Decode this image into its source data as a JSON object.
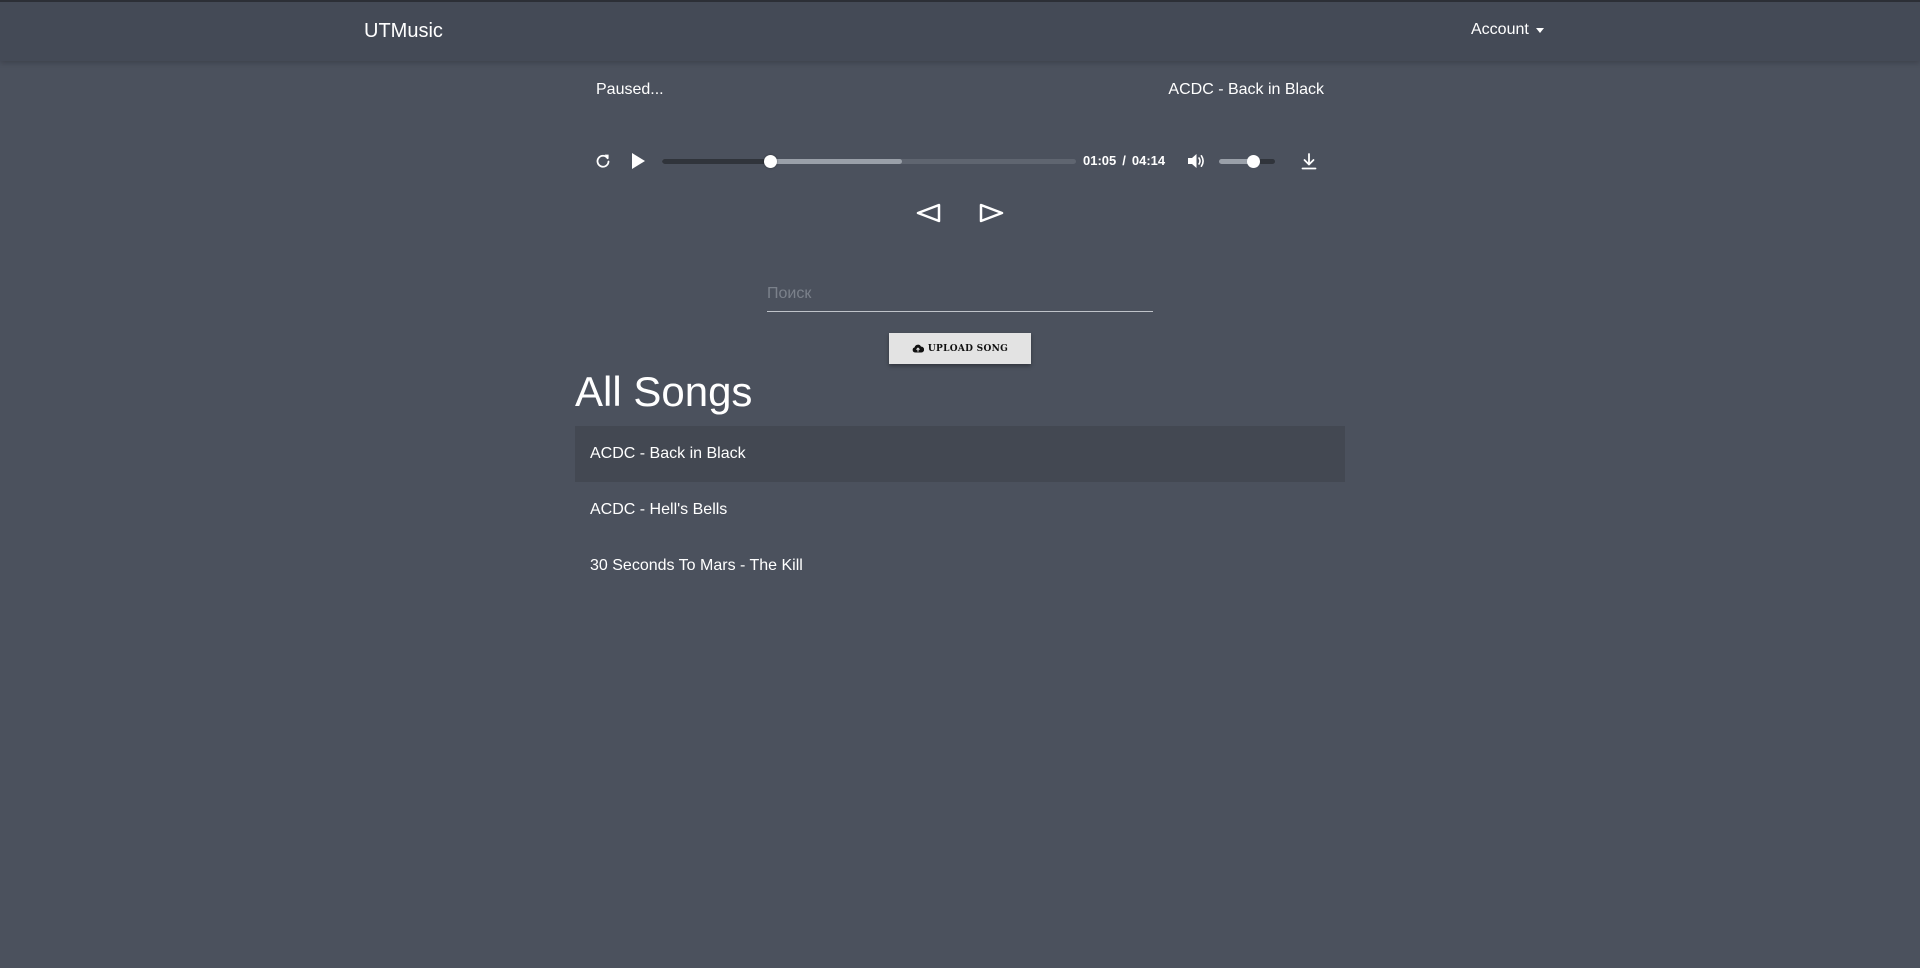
{
  "navbar": {
    "brand": "UTMusic",
    "account_label": "Account"
  },
  "player": {
    "status": "Paused...",
    "now_playing": "ACDC - Back in Black",
    "current_time": "01:05",
    "time_separator": "/",
    "duration": "04:14",
    "progress_fraction": 0.26,
    "buffered_fraction": 0.58,
    "volume_fraction": 0.6,
    "icons": [
      "restart-icon",
      "play-icon",
      "volume-icon",
      "download-icon",
      "previous-icon",
      "next-icon"
    ]
  },
  "search": {
    "placeholder": "Поиск",
    "value": ""
  },
  "upload": {
    "label": "UPLOAD SONG",
    "icon": "cloud-upload-icon"
  },
  "songs": {
    "title": "All Songs",
    "items": [
      {
        "label": "ACDC - Back in Black",
        "active": true
      },
      {
        "label": "ACDC - Hell's Bells",
        "active": false
      },
      {
        "label": "30 Seconds To Mars - The Kill",
        "active": false
      }
    ]
  },
  "colors": {
    "background": "#4b515d",
    "navbar": "#444a56",
    "active_row": "#434852",
    "text": "#ffffff"
  }
}
